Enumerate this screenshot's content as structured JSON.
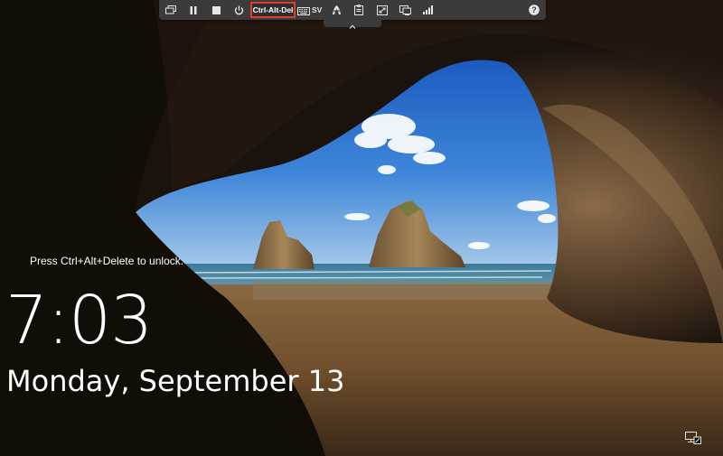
{
  "toolbar": {
    "buttons": [
      {
        "name": "window-mode-icon"
      },
      {
        "name": "pause-icon"
      },
      {
        "name": "stop-icon"
      },
      {
        "name": "power-icon"
      }
    ],
    "ctrl_alt_del_label": "Ctrl-Alt-Del",
    "keyboard_layout_label": "SV",
    "right_icons": [
      "accessibility-icon",
      "clipboard-icon",
      "fullscreen-icon",
      "display-icon",
      "signal-icon"
    ],
    "help_icon": "help-icon",
    "highlight_color": "#e23b2a",
    "background_color": "#3b3b3b"
  },
  "lockscreen": {
    "unlock_hint": "Press Ctrl+Alt+Delete to unlock.",
    "time": "7:03",
    "date": "Monday, September 13"
  },
  "system_tray": {
    "network_icon": "network-icon"
  },
  "colors": {
    "sky_top": "#1f63c6",
    "sky_bottom": "#7fb3e8",
    "sea": "#4c86a8",
    "sand": "#7a5a38",
    "cave": "#1a120c"
  }
}
